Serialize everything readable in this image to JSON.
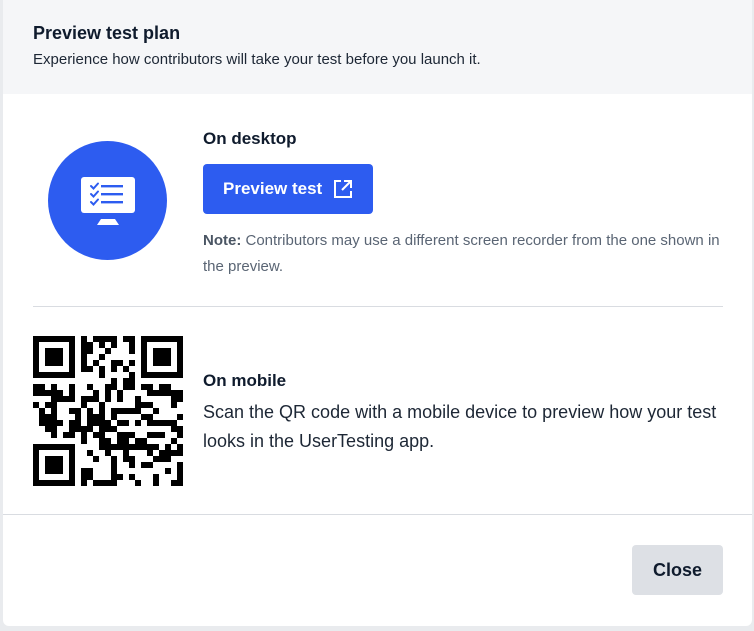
{
  "dialog": {
    "title": "Preview test plan",
    "subtitle": "Experience how contributors will take your test before you launch it."
  },
  "desktop": {
    "heading": "On desktop",
    "button_label": "Preview test",
    "button_icon": "external-link-icon",
    "icon": "desktop-monitor-icon",
    "note_label": "Note:",
    "note_text": " Contributors may use a different screen recorder from the one shown in the preview."
  },
  "mobile": {
    "heading": "On mobile",
    "description": "Scan the QR code with a mobile device to preview how your test looks in the UserTesting app.",
    "qr_icon": "qr-code-icon"
  },
  "footer": {
    "close_label": "Close"
  },
  "colors": {
    "accent": "#2d5cf0",
    "header_bg": "#f5f6f8",
    "close_bg": "#dde0e5",
    "text_dark": "#0f1b2d",
    "text_muted": "#5a6574"
  }
}
